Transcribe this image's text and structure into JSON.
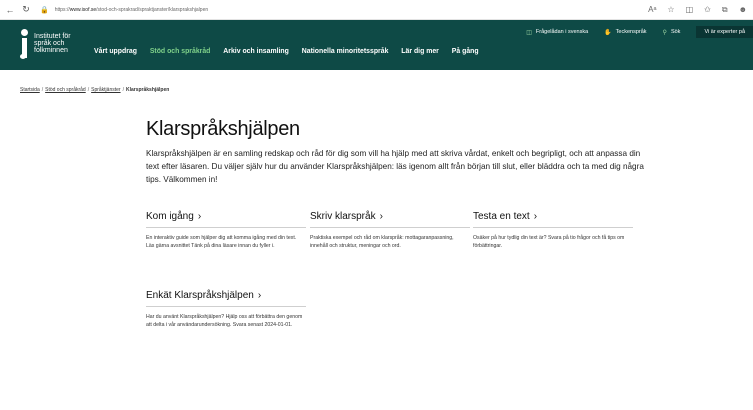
{
  "browser": {
    "url_prefix": "https://",
    "url_domain": "www.isof.se",
    "url_path": "/stod-och-sprakrad/spraktjanster/klarsprakshjalpen"
  },
  "header": {
    "logo_lines": [
      "Institutet för",
      "språk och",
      "folkminnen"
    ],
    "topbar": {
      "item1": "Frågelådan i svenska",
      "item2": "Teckenspråk",
      "search": "Sök",
      "cta": "Vi är experter på"
    },
    "nav": [
      "Vårt uppdrag",
      "Stöd och språkråd",
      "Arkiv och insamling",
      "Nationella minoritetsspråk",
      "Lär dig mer",
      "På gång"
    ]
  },
  "breadcrumb": {
    "items": [
      "Startsida",
      "Stöd och språkråd",
      "Språktjänster"
    ],
    "current": "Klarspråkshjälpen"
  },
  "main": {
    "title": "Klarspråkshjälpen",
    "intro": "Klarspråkshjälpen är en samling redskap och råd för dig som vill ha hjälp med att skriva vårdat, enkelt och begripligt, och att anpassa din text efter läsaren. Du väljer själv hur du använder Klarspråkshjälpen: läs igenom allt från början till slut, eller bläddra och ta med dig några tips. Välkommen in!"
  },
  "cards": [
    {
      "title": "Kom igång",
      "text": "En interaktiv guide som hjälper dig att komma igång med din text. Läs gärna avsnittet Tänk på dina läsare innan du fyller i."
    },
    {
      "title": "Skriv klarspråk",
      "text": "Praktiska exempel och råd om klarspråk: mottagaranpassning, innehåll och struktur, meningar och ord."
    },
    {
      "title": "Testa en text",
      "text": "Osäker på hur tydlig din text är? Svara på tio frågor och få tips om förbättringar."
    },
    {
      "title": "Enkät Klarspråkshjälpen",
      "text": "Har du använt Klarspråkshjälpen? Hjälp oss att förbättra den genom att delta i vår användarundersökning. Svara senast 2024-01-01."
    }
  ],
  "colors": {
    "header_bg": "#0e4a46",
    "nav_active": "#7fd18a"
  }
}
